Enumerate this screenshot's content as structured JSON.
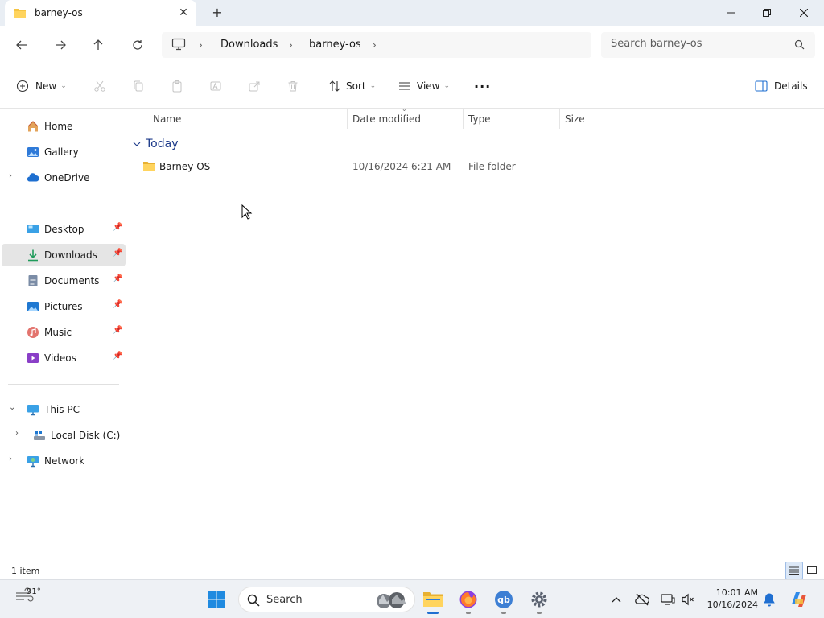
{
  "window": {
    "tab_title": "barney-os",
    "tab_close": "✕",
    "new_tab": "+"
  },
  "address": {
    "crumbs": [
      "Downloads",
      "barney-os"
    ],
    "separator": "›",
    "search_placeholder": "Search barney-os"
  },
  "toolbar": {
    "new_label": "New",
    "sort_label": "Sort",
    "view_label": "View",
    "more_label": "···",
    "details_label": "Details",
    "caret": "⌄"
  },
  "nav": {
    "quick": [
      {
        "label": "Home",
        "icon": "home-icon"
      },
      {
        "label": "Gallery",
        "icon": "gallery-icon"
      },
      {
        "label": "OneDrive",
        "icon": "cloud-icon"
      }
    ],
    "pinned": [
      {
        "label": "Desktop",
        "icon": "desktop-icon"
      },
      {
        "label": "Downloads",
        "icon": "download-icon"
      },
      {
        "label": "Documents",
        "icon": "documents-icon"
      },
      {
        "label": "Pictures",
        "icon": "pictures-icon"
      },
      {
        "label": "Music",
        "icon": "music-icon"
      },
      {
        "label": "Videos",
        "icon": "videos-icon"
      }
    ],
    "selected": "Downloads",
    "devices": [
      {
        "label": "This PC",
        "icon": "pc-icon"
      },
      {
        "label": "Local Disk (C:)",
        "icon": "drive-icon"
      },
      {
        "label": "Network",
        "icon": "network-icon"
      }
    ]
  },
  "columns": [
    "Name",
    "Date modified",
    "Type",
    "Size"
  ],
  "group": {
    "label": "Today"
  },
  "files": [
    {
      "name": "Barney OS",
      "date": "10/16/2024 6:21 AM",
      "type": "File folder",
      "size": ""
    }
  ],
  "status": {
    "item_count": "1 item"
  },
  "taskbar": {
    "temperature": "91°",
    "search_label": "Search",
    "time": "10:01 AM",
    "date": "10/16/2024"
  },
  "colors": {
    "accent": "#1f6fd1",
    "folder": "#f5c443",
    "group_heading": "#1c3a8a"
  }
}
